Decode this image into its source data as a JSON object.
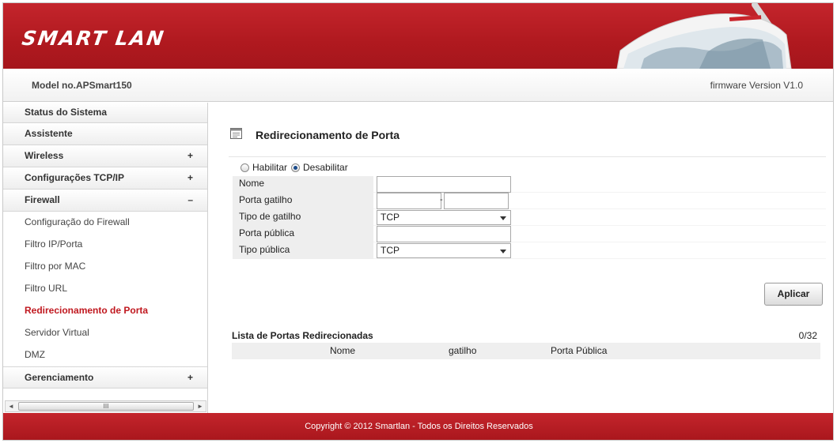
{
  "header": {
    "logo_text": "SMART LAN",
    "model": "Model no.APSmart150",
    "firmware": "firmware Version V1.0"
  },
  "sidebar": {
    "items": [
      {
        "label": "Status do Sistema",
        "type": "top",
        "sign": ""
      },
      {
        "label": "Assistente",
        "type": "top",
        "sign": ""
      },
      {
        "label": "Wireless",
        "type": "top",
        "sign": "+"
      },
      {
        "label": "Configurações TCP/IP",
        "type": "top",
        "sign": "+"
      },
      {
        "label": "Firewall",
        "type": "top",
        "sign": "–"
      },
      {
        "label": "Configuração do Firewall",
        "type": "sub"
      },
      {
        "label": "Filtro IP/Porta",
        "type": "sub"
      },
      {
        "label": "Filtro por MAC",
        "type": "sub"
      },
      {
        "label": "Filtro URL",
        "type": "sub"
      },
      {
        "label": "Redirecionamento de Porta",
        "type": "sub",
        "active": true
      },
      {
        "label": "Servidor Virtual",
        "type": "sub"
      },
      {
        "label": "DMZ",
        "type": "sub"
      },
      {
        "label": "Gerenciamento",
        "type": "top",
        "sign": "+"
      }
    ],
    "scroll_left": "◄",
    "scroll_right": "►",
    "scroll_grip": "III"
  },
  "main": {
    "title": "Redirecionamento de Porta",
    "enable_label": "Habilitar",
    "disable_label": "Desabilitar",
    "selected_mode": "Desabilitar",
    "fields": {
      "nome": {
        "label": "Nome",
        "value": ""
      },
      "porta_gatilho": {
        "label": "Porta gatilho",
        "value_from": "",
        "value_to": "",
        "separator": "-"
      },
      "tipo_gatilho": {
        "label": "Tipo de gatilho",
        "value": "TCP"
      },
      "porta_publica": {
        "label": "Porta pública",
        "value": ""
      },
      "tipo_publica": {
        "label": "Tipo pública",
        "value": "TCP"
      }
    },
    "apply_label": "Aplicar",
    "list": {
      "title": "Lista de Portas Redirecionadas",
      "count": "0/32",
      "columns": [
        "Nome",
        "gatilho",
        "Porta Pública"
      ],
      "rows": []
    }
  },
  "footer": {
    "copyright": "Copyright © 2012 Smartlan - Todos os Direitos Reservados"
  },
  "colors": {
    "brand_red": "#b0191f",
    "active_link": "#c0181f"
  }
}
